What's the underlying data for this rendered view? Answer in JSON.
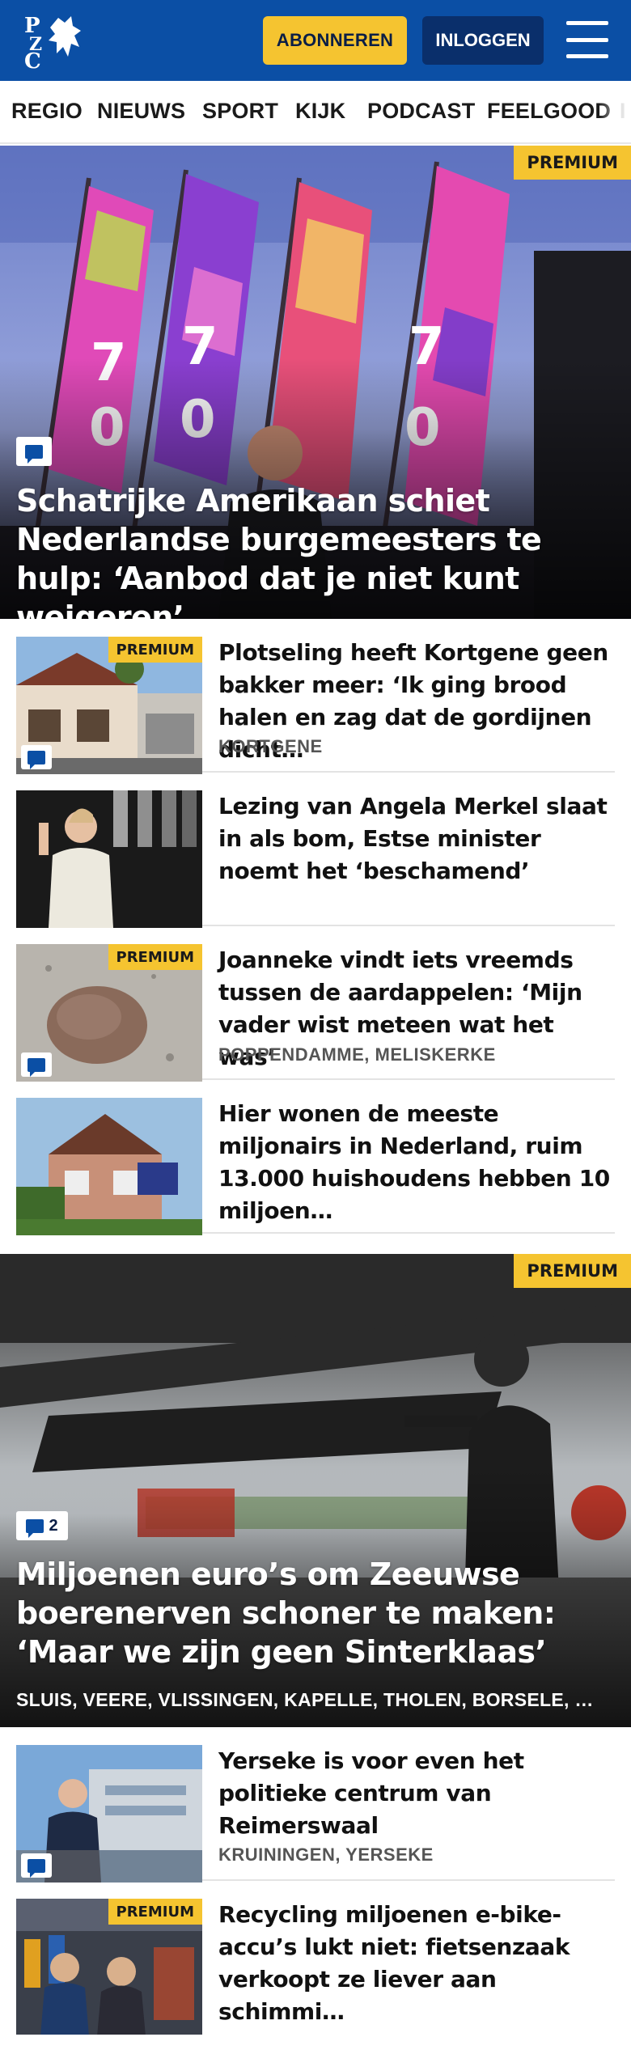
{
  "header": {
    "logo_text": "PZC",
    "subscribe_label": "ABONNEREN",
    "login_label": "INLOGGEN",
    "brand_color": "#0b4fa5",
    "accent_color": "#f5c430"
  },
  "nav": {
    "items": [
      "REGIO",
      "NIEUWS",
      "SPORT",
      "KIJK",
      "PODCAST",
      "FEELGOOD"
    ]
  },
  "hero1": {
    "badge": "PREMIUM",
    "title": "Schatrijke Amerikaan schiet Nederlandse burgemeesters te hulp: ‘Aanbod dat je niet kunt weigeren’",
    "comment_icon": "comment-icon"
  },
  "articles1": [
    {
      "badge": "PREMIUM",
      "title": "Plotseling heeft Kortgene geen bakker meer: ‘Ik ging brood halen en zag dat de gordijnen dicht…",
      "location": "KORTGENE",
      "has_comment": true
    },
    {
      "badge": "",
      "title": "Lezing van Angela Merkel slaat in als bom, Estse minister noemt het ‘beschamend’",
      "location": "",
      "has_comment": false
    },
    {
      "badge": "PREMIUM",
      "title": "Joanneke vindt iets vreemds tussen de aardappelen: ‘Mijn vader wist meteen wat het was’",
      "location": "POPPENDAMME, MELISKERKE",
      "has_comment": true
    },
    {
      "badge": "",
      "title": "Hier wonen de meeste miljonairs in Nederland, ruim 13.000 huishoudens hebben 10 miljoen…",
      "location": "",
      "has_comment": false
    }
  ],
  "hero2": {
    "badge": "PREMIUM",
    "comment_count": "2",
    "title": "Miljoenen euro’s om Zeeuwse boerenerven schoner te maken: ‘Maar we zijn geen Sinterklaas’",
    "locations": "SLUIS, VEERE, VLISSINGEN, KAPELLE, THOLEN, BORSELE, …"
  },
  "articles2": [
    {
      "badge": "",
      "title": "Yerseke is voor even het politieke centrum van Reimerswaal",
      "location": "KRUININGEN, YERSEKE",
      "has_comment": true
    },
    {
      "badge": "PREMIUM",
      "title": "Recycling miljoenen e-bike-accu’s lukt niet: fietsenzaak verkoopt ze liever aan schimmi…",
      "location": "",
      "has_comment": false
    }
  ]
}
